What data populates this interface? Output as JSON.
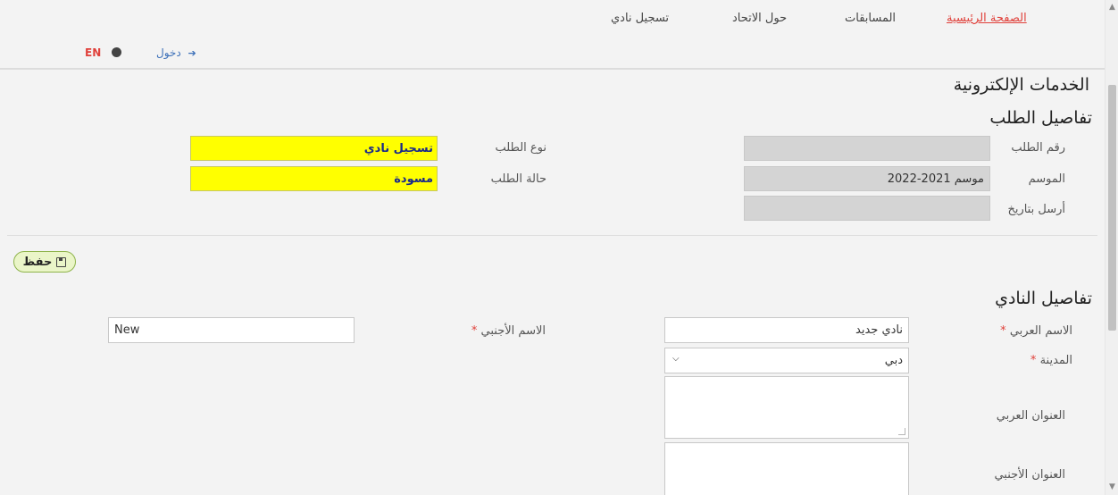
{
  "nav": {
    "home": "الصفحة الرئيسية",
    "competitions": "المسابقات",
    "about": "حول الاتحاد",
    "club_registration": "تسجيل نادي",
    "login": "دخول",
    "language": "EN"
  },
  "page_title": "الخدمات الإلكترونية",
  "request": {
    "heading": "تفاصيل الطلب",
    "request_number_label": "رقم الطلب",
    "request_number_value": "",
    "season_label": "الموسم",
    "season_value": "موسم 2021-2022",
    "sent_date_label": "أرسل بتاريخ",
    "sent_date_value": "",
    "request_type_label": "نوع الطلب",
    "request_type_value": "تسجيل نادي",
    "request_status_label": "حالة الطلب",
    "request_status_value": "مسودة"
  },
  "save_label": "حفظ",
  "club": {
    "heading": "تفاصيل النادي",
    "arabic_name_label": "الاسم العربي",
    "arabic_name_value": "نادي جديد",
    "foreign_name_label": "الاسم الأجنبي",
    "foreign_name_value": "New",
    "city_label": "المدينة",
    "city_value": "دبي",
    "arabic_address_label": "العنوان العربي",
    "foreign_address_label": "العنوان الأجنبي",
    "required_mark": "*"
  },
  "colors": {
    "accent_red": "#e0403a",
    "link_blue": "#3b6fb8",
    "highlight_yellow": "#ffff00",
    "save_green": "#eaf5c8"
  }
}
